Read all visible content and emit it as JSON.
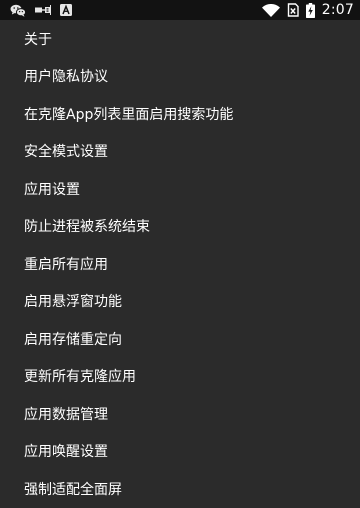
{
  "status_bar": {
    "time": "2:07",
    "icons": [
      "wechat-icon",
      "usb-icon",
      "notification-a-icon",
      "wifi-icon",
      "no-sim-icon",
      "battery-charging-icon"
    ],
    "background": "#121212"
  },
  "menu": {
    "background": "#2b2b2b",
    "text_color": "#ffffff",
    "items": [
      {
        "label": "关于"
      },
      {
        "label": "用户隐私协议"
      },
      {
        "label": "在克隆App列表里面启用搜索功能"
      },
      {
        "label": "安全模式设置"
      },
      {
        "label": "应用设置"
      },
      {
        "label": "防止进程被系统结束"
      },
      {
        "label": "重启所有应用"
      },
      {
        "label": "启用悬浮窗功能"
      },
      {
        "label": "启用存储重定向"
      },
      {
        "label": "更新所有克隆应用"
      },
      {
        "label": "应用数据管理"
      },
      {
        "label": "应用唤醒设置"
      },
      {
        "label": "强制适配全面屏"
      }
    ]
  }
}
